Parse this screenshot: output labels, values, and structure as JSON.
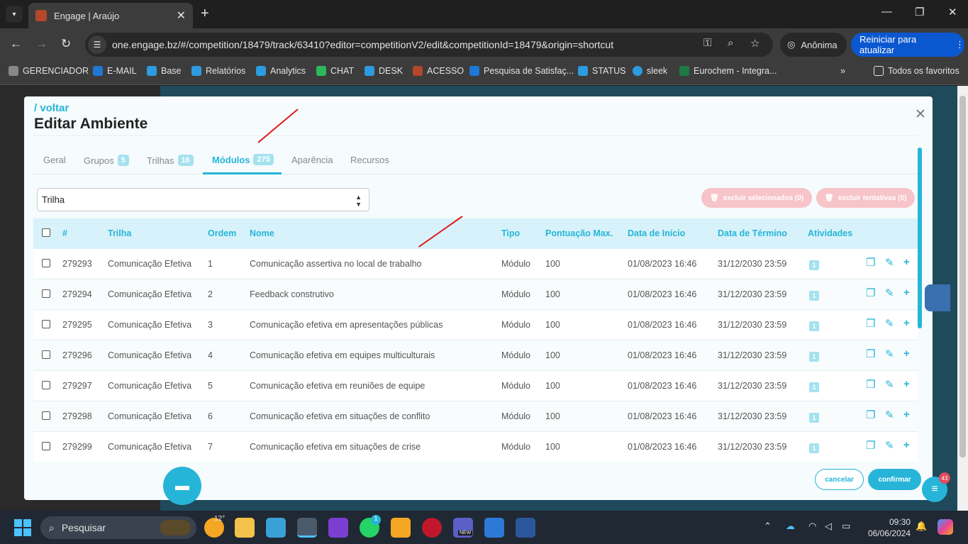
{
  "browser": {
    "tab_title": "Engage | Araújo",
    "url": "one.engage.bz/#/competition/18479/track/63410?editor=competitionV2/edit&competitionId=18479&origin=shortcut",
    "incognito_label": "Anônima",
    "update_label": "Reiniciar para atualizar",
    "bookmarks": [
      "GERENCIADOR",
      "E-MAIL",
      "Base",
      "Relatórios",
      "Analytics",
      "CHAT",
      "DESK",
      "ACESSO",
      "Pesquisa de Satisfaç...",
      "STATUS",
      "sleek",
      "Eurochem - Integra..."
    ],
    "all_bookmarks_label": "Todos os favoritos",
    "bookmark_colors": [
      "#888888",
      "#1e78d4",
      "#2d9be0",
      "#2d9be0",
      "#2d9be0",
      "#2eb85c",
      "#2d9be0",
      "#b5472a",
      "#1e78d4",
      "#2d9be0",
      "#2d9be0",
      "#1d7a43"
    ]
  },
  "modal": {
    "back_label": "/ voltar",
    "title": "Editar Ambiente",
    "tabs": [
      {
        "label": "Geral",
        "count": ""
      },
      {
        "label": "Grupos",
        "count": "5"
      },
      {
        "label": "Trilhas",
        "count": "16"
      },
      {
        "label": "Módulos",
        "count": "275"
      },
      {
        "label": "Aparência",
        "count": ""
      },
      {
        "label": "Recursos",
        "count": ""
      }
    ],
    "active_tab": "Módulos",
    "select_value": "Trilha",
    "delete_selected_label": "excluir selecionados (0)",
    "delete_attempts_label": "excluir tentativas (0)",
    "cancel_label": "cancelar",
    "confirm_label": "confirmar",
    "accent_color": "#26b5d8"
  },
  "table": {
    "columns": [
      "#",
      "Trilha",
      "Ordem",
      "Nome",
      "Tipo",
      "Pontuação Max.",
      "Data de Início",
      "Data de Término",
      "Atividades"
    ],
    "rows": [
      [
        "279293",
        "Comunicação Efetiva",
        "1",
        "Comunicação assertiva no local de trabalho",
        "Módulo",
        "100",
        "01/08/2023 16:46",
        "31/12/2030 23:59",
        "1"
      ],
      [
        "279294",
        "Comunicação Efetiva",
        "2",
        "Feedback construtivo",
        "Módulo",
        "100",
        "01/08/2023 16:46",
        "31/12/2030 23:59",
        "1"
      ],
      [
        "279295",
        "Comunicação Efetiva",
        "3",
        "Comunicação efetiva em apresentações públicas",
        "Módulo",
        "100",
        "01/08/2023 16:46",
        "31/12/2030 23:59",
        "1"
      ],
      [
        "279296",
        "Comunicação Efetiva",
        "4",
        "Comunicação efetiva em equipes multiculturais",
        "Módulo",
        "100",
        "01/08/2023 16:46",
        "31/12/2030 23:59",
        "1"
      ],
      [
        "279297",
        "Comunicação Efetiva",
        "5",
        "Comunicação efetiva em reuniões de equipe",
        "Módulo",
        "100",
        "01/08/2023 16:46",
        "31/12/2030 23:59",
        "1"
      ],
      [
        "279298",
        "Comunicação Efetiva",
        "6",
        "Comunicação efetiva em situações de conflito",
        "Módulo",
        "100",
        "01/08/2023 16:46",
        "31/12/2030 23:59",
        "1"
      ],
      [
        "279299",
        "Comunicação Efetiva",
        "7",
        "Comunicação efetiva em situações de crise",
        "Módulo",
        "100",
        "01/08/2023 16:46",
        "31/12/2030 23:59",
        "1"
      ]
    ]
  },
  "widgets": {
    "bot_badge": "43"
  },
  "taskbar": {
    "search_placeholder": "Pesquisar",
    "weather": "12°",
    "whatsapp_badge": "1",
    "teams_label": "NEW",
    "time": "09:30",
    "date": "06/06/2024"
  }
}
